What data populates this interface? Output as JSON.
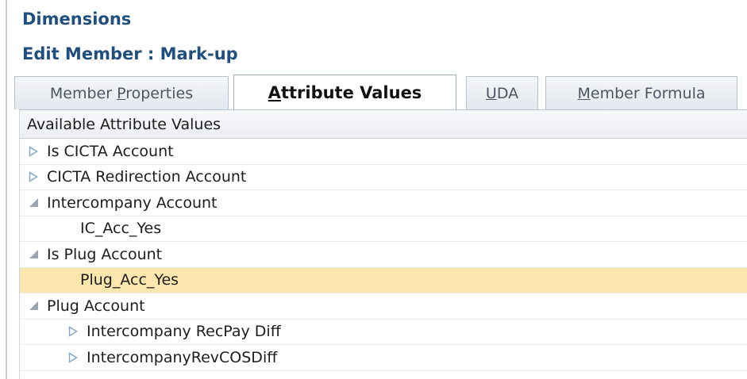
{
  "breadcrumb": {
    "title": "Dimensions"
  },
  "page": {
    "title": "Edit Member : Mark-up"
  },
  "tabs": [
    {
      "pre": "Member ",
      "acc": "P",
      "post": "roperties"
    },
    {
      "pre": "",
      "acc": "A",
      "post": "ttribute Values"
    },
    {
      "pre": "",
      "acc": "U",
      "post": "DA"
    },
    {
      "pre": "",
      "acc": "M",
      "post": "ember Formula"
    }
  ],
  "tree": {
    "header": "Available Attribute Values",
    "rows": [
      {
        "label": "Is CICTA Account",
        "state": "collapsed"
      },
      {
        "label": "CICTA Redirection Account",
        "state": "collapsed"
      },
      {
        "label": "Intercompany Account",
        "state": "expanded"
      },
      {
        "label": "IC_Acc_Yes",
        "state": "leaf"
      },
      {
        "label": "Is Plug Account",
        "state": "expanded"
      },
      {
        "label": "Plug_Acc_Yes",
        "state": "leaf",
        "selected": true
      },
      {
        "label": "Plug Account",
        "state": "expanded"
      },
      {
        "label": "Intercompany RecPay Diff",
        "state": "collapsed"
      },
      {
        "label": "IntercompanyRevCOSDiff",
        "state": "collapsed"
      }
    ]
  },
  "colors": {
    "heading": "#1f4f7f",
    "selected_row": "#fbe6ad",
    "expander": "#7fa3c9"
  },
  "icons": {
    "collapsed": "triangle-right-outline-icon",
    "expanded": "triangle-down-right-filled-icon"
  }
}
